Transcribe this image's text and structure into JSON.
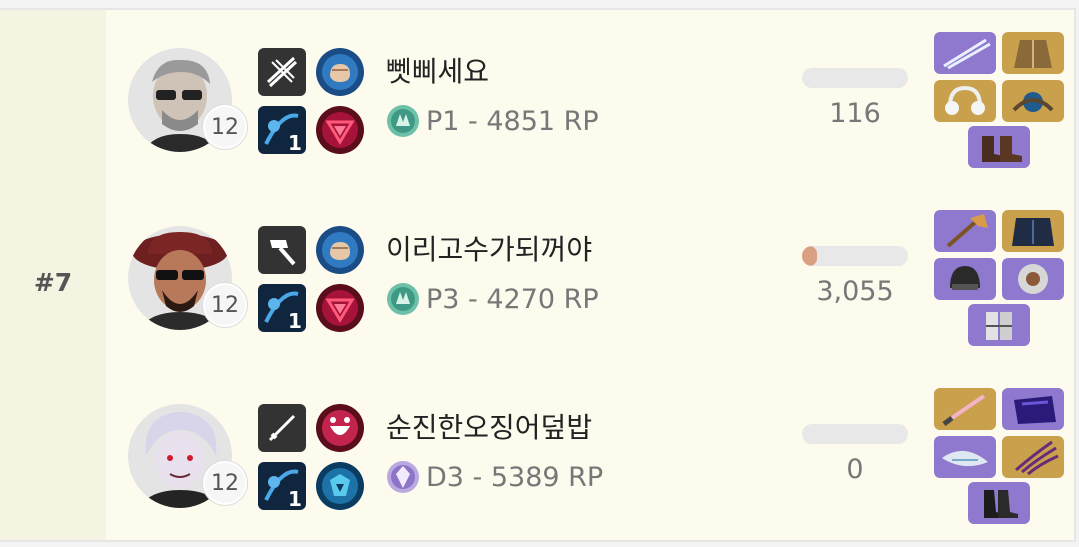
{
  "team": {
    "rank": "#7",
    "players": [
      {
        "name": "뻿삐세요",
        "level": "12",
        "tier": "P1 - 4851 RP",
        "tier_icon": "platinum-tier-icon",
        "stat_value": "116",
        "stat_fill": 0.0,
        "weapon_icon": "crossed-rifles-icon",
        "skill_icon_1": "fist-punch-icon",
        "skill_icon_2": "dash-skill-icon",
        "skill_badge": "1",
        "skill_icon_3": "red-triangle-icon",
        "items": [
          "dual-swords-item",
          "armor-jacket-item",
          "headphones-item",
          "orb-item",
          "boots-item"
        ]
      },
      {
        "name": "이리고수가되꺼야",
        "level": "12",
        "tier": "P3 - 4270 RP",
        "tier_icon": "platinum-tier-icon",
        "stat_value": "3,055",
        "stat_fill": 0.14,
        "weapon_icon": "hammer-icon",
        "skill_icon_1": "fist-punch-icon",
        "skill_icon_2": "dash-skill-icon",
        "skill_badge": "1",
        "skill_icon_3": "red-triangle-icon",
        "items": [
          "war-axe-item",
          "dark-armor-item",
          "helmet-item",
          "disc-item",
          "gauntlet-item"
        ]
      },
      {
        "name": "순진한오징어덮밥",
        "level": "12",
        "tier": "D3 - 5389 RP",
        "tier_icon": "diamond-tier-icon",
        "stat_value": "0",
        "stat_fill": 0.0,
        "weapon_icon": "katana-icon",
        "skill_icon_1": "laughing-mask-icon",
        "skill_icon_2": "dash-skill-icon",
        "skill_badge": "1",
        "skill_icon_3": "blue-emblem-icon",
        "items": [
          "light-saber-item",
          "purple-cloak-item",
          "spiked-blade-item",
          "claw-item",
          "dark-boots-item"
        ]
      }
    ]
  },
  "colors": {
    "purple_item": "#8f79cf",
    "gold_item": "#c9a04c",
    "fill": "#d9a182"
  }
}
